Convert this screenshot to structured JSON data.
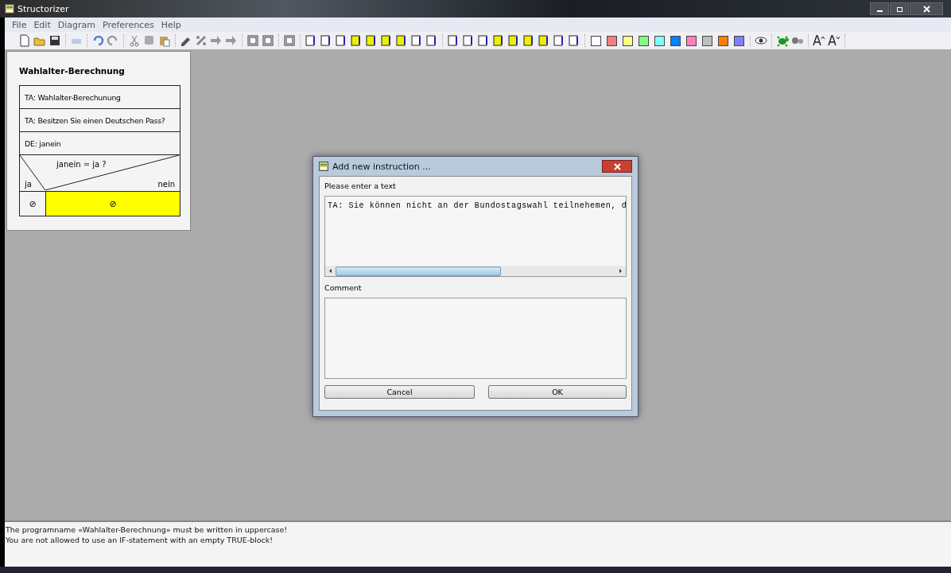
{
  "window": {
    "title": "Structorizer"
  },
  "menu": [
    "File",
    "Edit",
    "Diagram",
    "Preferences",
    "Help"
  ],
  "palette": [
    {
      "color": "#ffffff"
    },
    {
      "color": "#f08080"
    },
    {
      "color": "#ffff80"
    },
    {
      "color": "#80ff80"
    },
    {
      "color": "#80ffff"
    },
    {
      "color": "#0080ff"
    },
    {
      "color": "#ff80c0"
    },
    {
      "color": "#c0c0c0"
    },
    {
      "color": "#ff8000"
    },
    {
      "color": "#8080ff"
    }
  ],
  "diagram": {
    "title": "Wahlalter-Berechnung",
    "blocks": [
      {
        "kind": "instruction",
        "text": "TA: Wahlalter-Berechunung"
      },
      {
        "kind": "instruction",
        "text": "TA: Besitzen Sie einen Deutschen Pass?"
      },
      {
        "kind": "instruction",
        "text": "DE: janein"
      },
      {
        "kind": "if",
        "left": "janein",
        "operator": "=",
        "right": "ja ?",
        "true_label": "ja",
        "false_label": "nein",
        "branches": [
          {
            "text": "⊘",
            "color": "#f4f4f4"
          },
          {
            "text": "⊘",
            "color": "#ffff00"
          }
        ]
      }
    ]
  },
  "dialog": {
    "title": "Add new instruction ...",
    "text_label": "Please enter a text",
    "text_value": "TA: Sie können nicht an der Bundostagswahl teilnehemen, d",
    "comment_label": "Comment",
    "buttons": [
      "Cancel",
      "OK"
    ]
  },
  "messages": [
    "The programname «Wahlalter-Berechnung» must be written in uppercase!",
    "You are not allowed to use an IF-statement with an empty TRUE-block!"
  ]
}
